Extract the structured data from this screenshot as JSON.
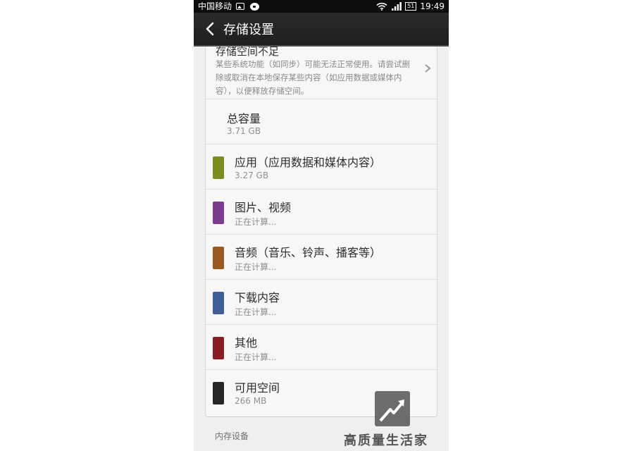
{
  "status_bar": {
    "carrier": "中国移动",
    "battery": "51",
    "time": "19:49"
  },
  "title_bar": {
    "title": "存储设置"
  },
  "warning": {
    "title": "存储空间不足",
    "description": "某些系统功能（如同步）可能无法正常使用。请尝试删除或取消在本地保存某些内容（如应用数据或媒体内容），以便释放存储空间。"
  },
  "total": {
    "label": "总容量",
    "value": "3.71 GB"
  },
  "categories": [
    {
      "label": "应用（应用数据和媒体内容）",
      "value": "3.27 GB",
      "color": "#7d8c1e"
    },
    {
      "label": "图片、视频",
      "value": "正在计算...",
      "color": "#7e3b8f"
    },
    {
      "label": "音频（音乐、铃声、播客等）",
      "value": "正在计算...",
      "color": "#9a5a1f"
    },
    {
      "label": "下载内容",
      "value": "正在计算...",
      "color": "#3f5f99"
    },
    {
      "label": "其他",
      "value": "正在计算...",
      "color": "#8a1e23"
    },
    {
      "label": "可用空间",
      "value": "266 MB",
      "color": "#262626"
    }
  ],
  "section": {
    "label": "内存设备"
  },
  "watermark": {
    "text": "高质量生活家",
    "icon": "rising-arrow-icon"
  }
}
